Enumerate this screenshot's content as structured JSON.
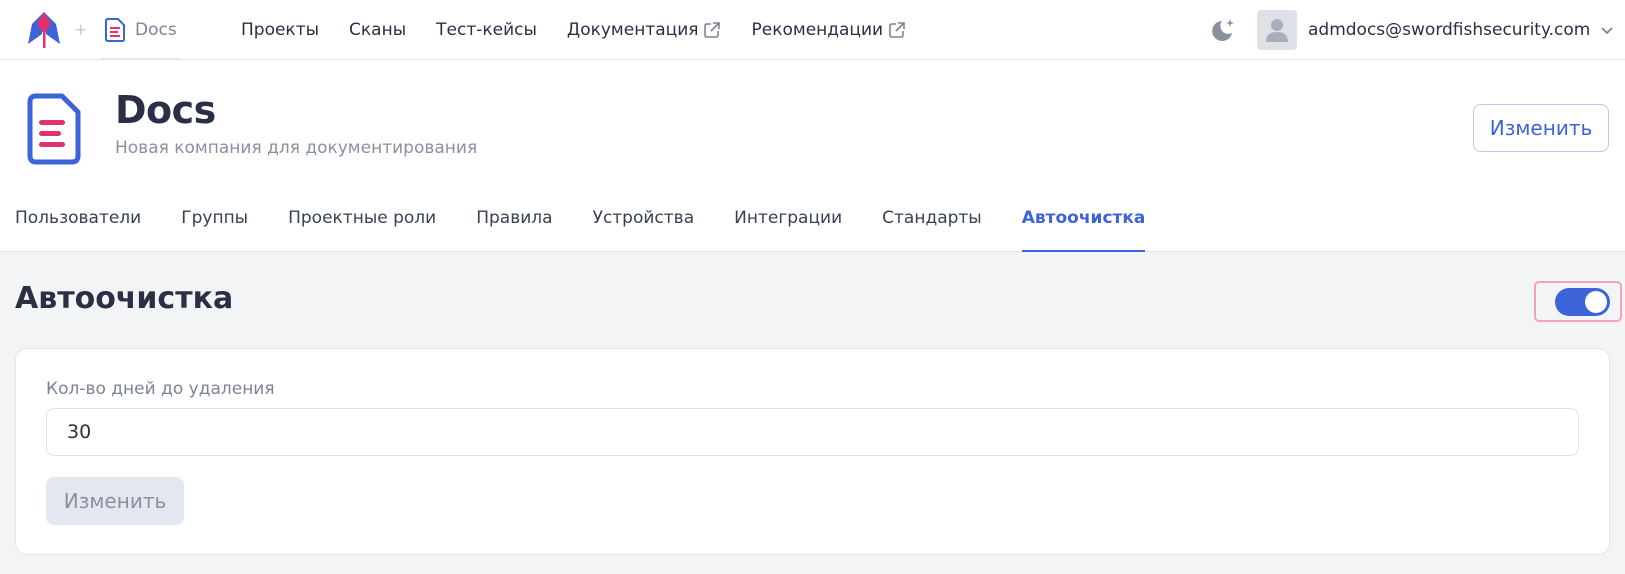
{
  "topbar": {
    "breadcrumb_label": "Docs",
    "plus_symbol": "+",
    "nav": [
      {
        "label": "Проекты",
        "external": false
      },
      {
        "label": "Сканы",
        "external": false
      },
      {
        "label": "Тест-кейсы",
        "external": false
      },
      {
        "label": "Документация",
        "external": true
      },
      {
        "label": "Рекомендации",
        "external": true
      }
    ],
    "theme_icon": "moon-icon",
    "user_email": "admdocs@swordfishsecurity.com"
  },
  "header": {
    "company_name": "Docs",
    "company_description": "Новая компания для документирования",
    "edit_label": "Изменить",
    "tabs": [
      {
        "label": "Пользователи",
        "active": false
      },
      {
        "label": "Группы",
        "active": false
      },
      {
        "label": "Проектные роли",
        "active": false
      },
      {
        "label": "Правила",
        "active": false
      },
      {
        "label": "Устройства",
        "active": false
      },
      {
        "label": "Интеграции",
        "active": false
      },
      {
        "label": "Стандарты",
        "active": false
      },
      {
        "label": "Автоочистка",
        "active": true
      }
    ]
  },
  "autoclean": {
    "title": "Автоочистка",
    "enabled": true,
    "days_label": "Кол-во дней до удаления",
    "days_value": "30",
    "save_label": "Изменить"
  },
  "colors": {
    "accent": "#3d63d9",
    "brand_red": "#e0336e",
    "focus_ring": "#f2a2bd"
  }
}
